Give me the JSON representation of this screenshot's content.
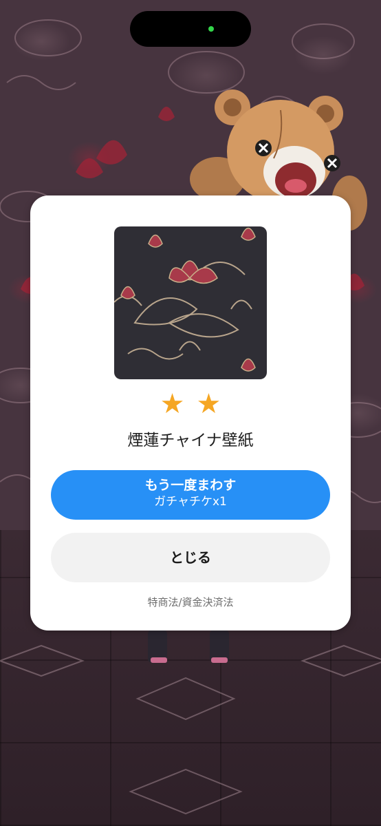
{
  "modal": {
    "stars": [
      "★",
      "★"
    ],
    "item_name": "煙蓮チャイナ壁紙",
    "spin_again": {
      "title": "もう一度まわす",
      "cost": "ガチャチケx1"
    },
    "close_label": "とじる",
    "legal_link": "特商法/資金決済法"
  },
  "colors": {
    "accent": "#2790f6",
    "star": "#f5a623",
    "status_dot": "#33d54a"
  },
  "icons": {
    "star": "star-icon",
    "status": "camera-indicator-dot"
  }
}
